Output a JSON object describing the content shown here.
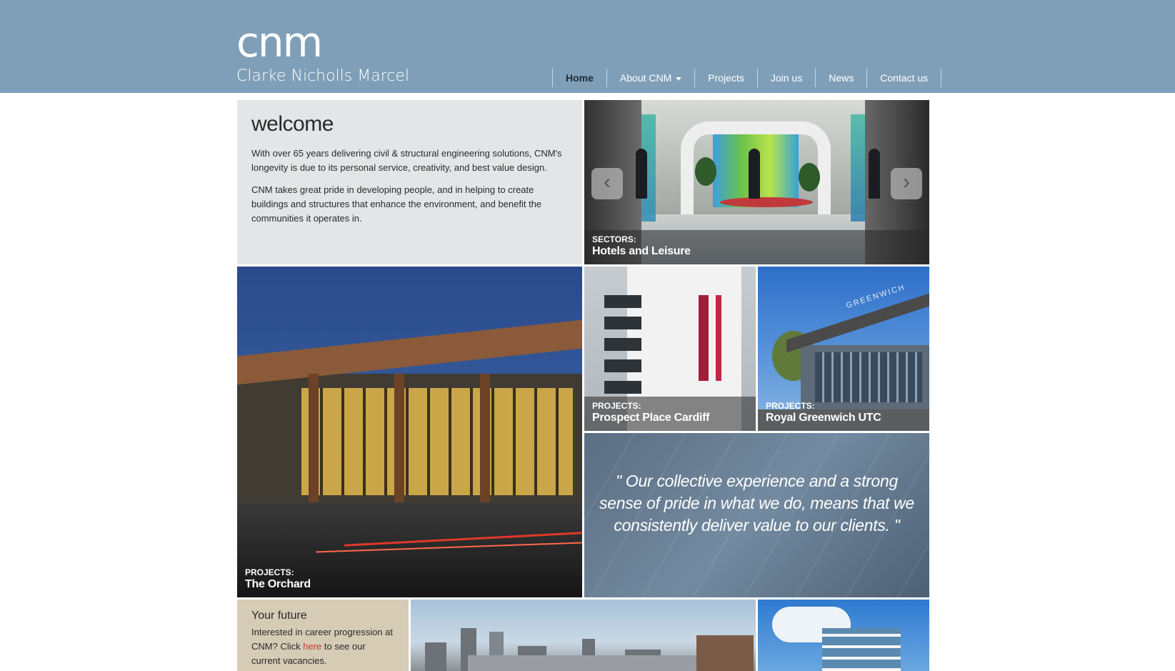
{
  "header": {
    "logo_mark": "cnm",
    "logo_name": "Clarke Nicholls Marcel",
    "nav": [
      {
        "label": "Home",
        "active": true
      },
      {
        "label": "About CNM",
        "has_dropdown": true
      },
      {
        "label": "Projects"
      },
      {
        "label": "Join us"
      },
      {
        "label": "News"
      },
      {
        "label": "Contact us"
      }
    ]
  },
  "welcome": {
    "title": "welcome",
    "para1": "With over 65 years delivering civil & structural engineering solutions, CNM's longevity is due to its personal service, creativity, and best value design.",
    "para2": "CNM takes great pride in developing people, and in helping to create buildings and structures that enhance the environment, and benefit the communities it operates in."
  },
  "slider": {
    "kicker": "SECTORS:",
    "title": "Hotels and Leisure",
    "prev_icon": "chevron-left-icon",
    "next_icon": "chevron-right-icon"
  },
  "tiles": {
    "orchard": {
      "kicker": "PROJECTS:",
      "title": "The Orchard"
    },
    "prospect": {
      "kicker": "PROJECTS:",
      "title": "Prospect Place Cardiff"
    },
    "greenwich": {
      "kicker": "PROJECTS:",
      "title": "Royal Greenwich UTC",
      "sign": "GREENWICH"
    }
  },
  "quote": {
    "text": "\" Our collective experience and a strong sense of pride in what we do, means that we consistently deliver value to our clients. \""
  },
  "future": {
    "title": "Your future",
    "text_before": "Interested in career progression at CNM?  Click ",
    "link": "here",
    "text_after": " to see our current vacancies."
  },
  "colors": {
    "header_bg": "#7f9fb8",
    "welcome_bg": "#e3e5e6",
    "future_bg": "#d6ccb6",
    "link": "#c0392b"
  }
}
